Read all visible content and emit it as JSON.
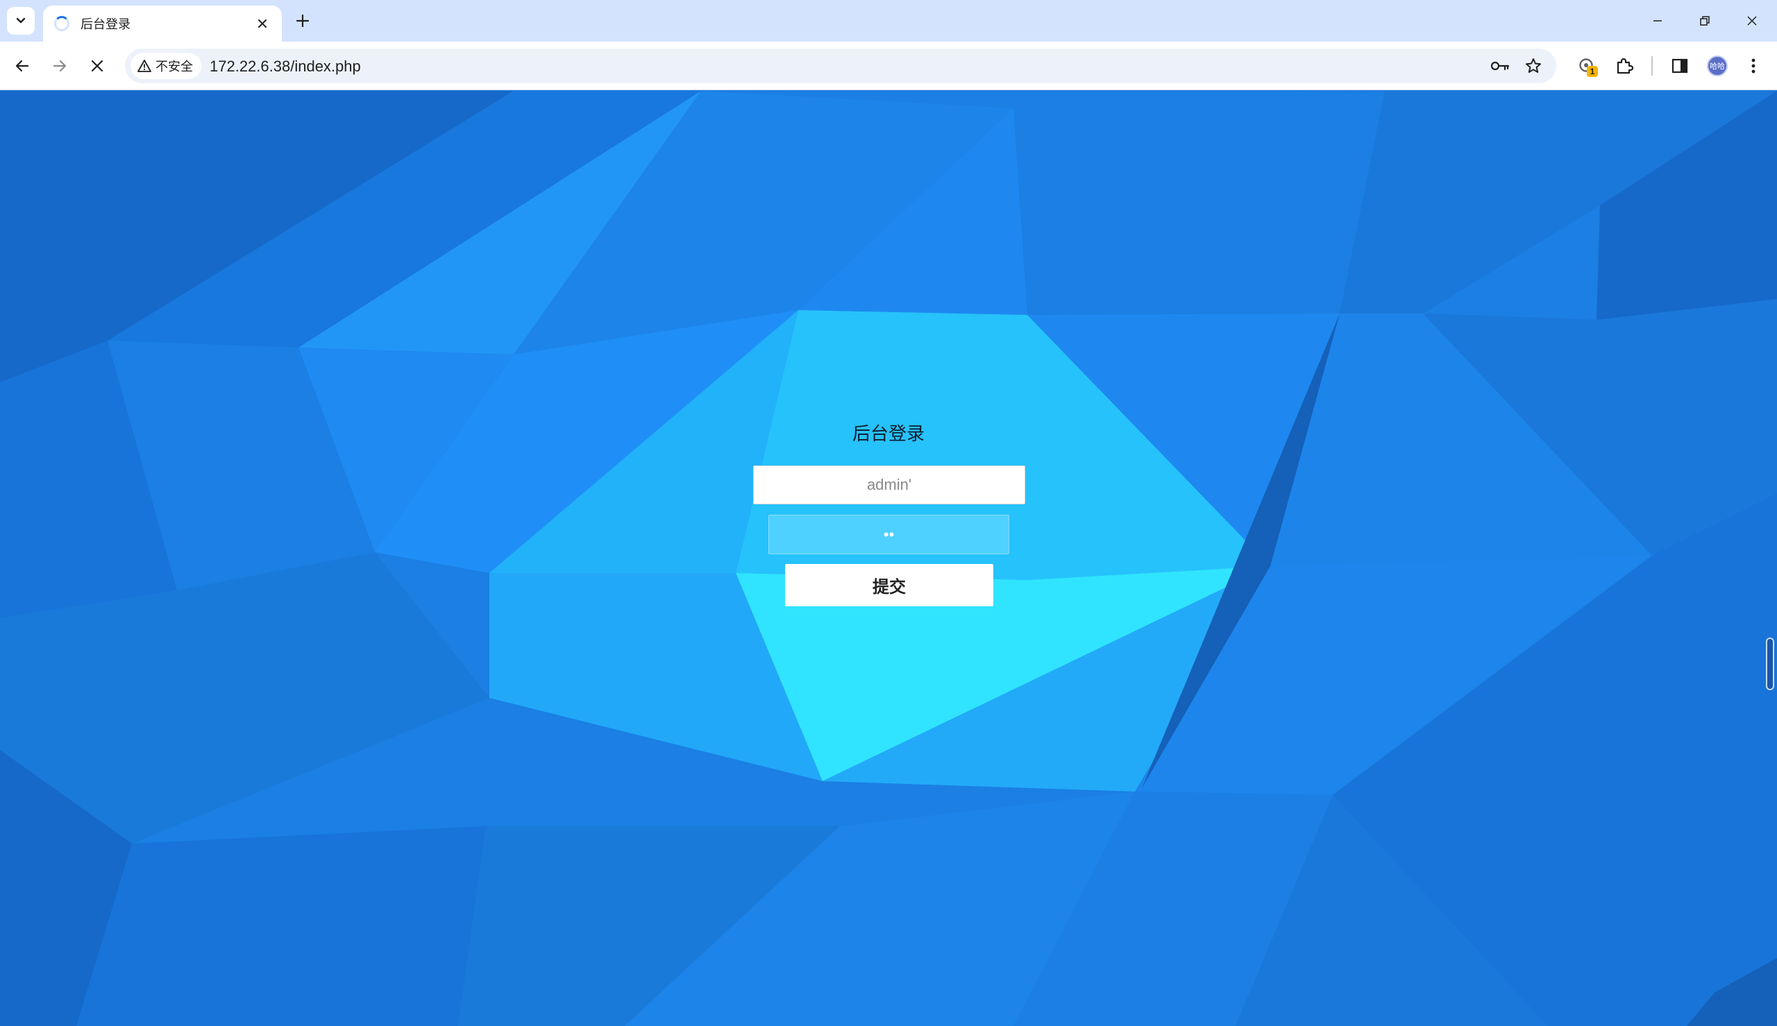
{
  "browser": {
    "tab": {
      "title": "后台登录"
    },
    "omnibox": {
      "security_label": "不安全",
      "url": "172.22.6.38/index.php"
    },
    "extensions_badge": "1",
    "profile_avatar_text": "哈哈"
  },
  "login": {
    "title": "后台登录",
    "username_value": "admin'",
    "password_value": "••",
    "submit_label": "提交"
  },
  "colors": {
    "page_background": "#1b7fe3",
    "password_field": "#4fd1ff",
    "tab_strip": "#d3e3fd"
  }
}
